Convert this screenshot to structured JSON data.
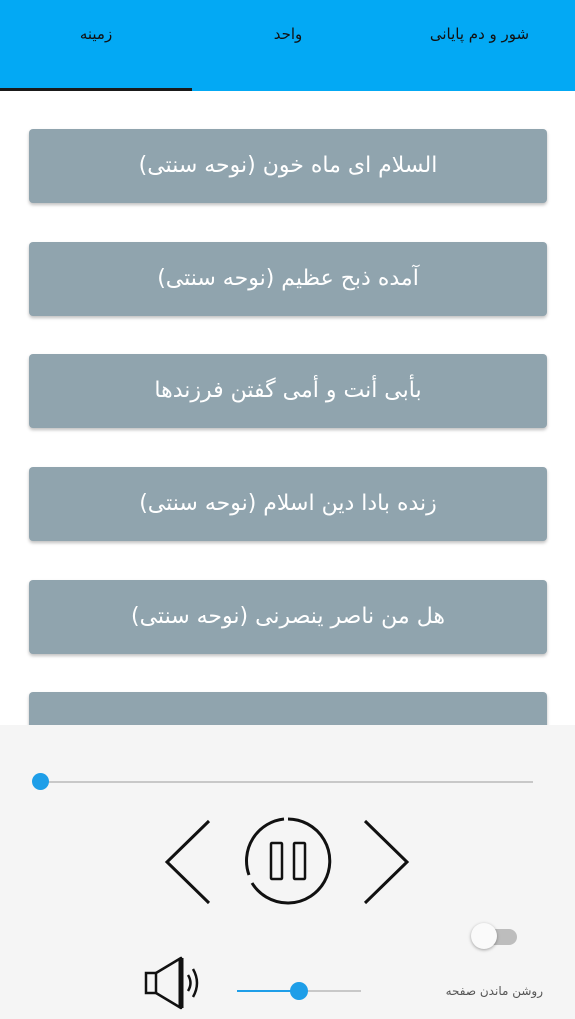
{
  "tabs": [
    {
      "label": "شور و دم پایانی"
    },
    {
      "label": "واحد"
    },
    {
      "label": "زمینه"
    }
  ],
  "selected_tab": "زمینه",
  "list": {
    "items": [
      {
        "label": "السلام ای ماه خون (نوحه سنتی)"
      },
      {
        "label": "آمده ذبح عظیم (نوحه سنتی)"
      },
      {
        "label": "بأبی أنت و أمی گفتن فرزندها"
      },
      {
        "label": "زنده بادا دین اسلام (نوحه سنتی)"
      },
      {
        "label": "هل من ناصر ینصرنی (نوحه سنتی)"
      }
    ]
  },
  "player": {
    "seek_progress": 0.0,
    "volume_level": 0.5,
    "keep_screen_on_label": "روشن ماندن صفحه",
    "keep_screen_on": false
  },
  "colors": {
    "accent": "#03A9F4",
    "item_bg": "#90A4AE",
    "slider": "#1E9EE8"
  },
  "icons": [
    "previous-icon",
    "pause-icon",
    "next-icon",
    "volume-icon"
  ]
}
